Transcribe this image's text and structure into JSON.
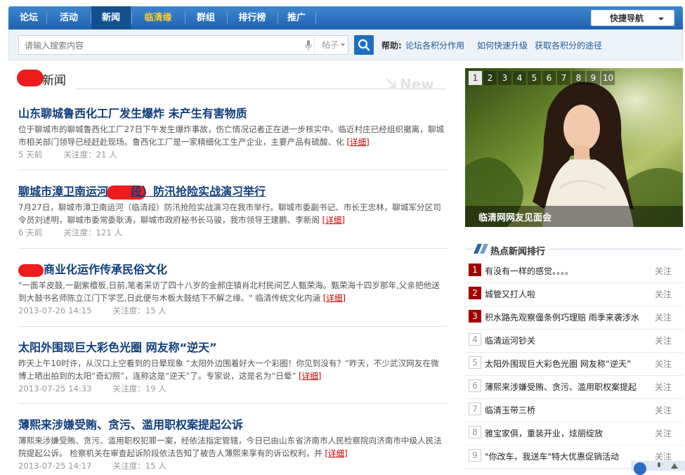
{
  "topnav": {
    "items": [
      "论坛",
      "活动",
      "新闻",
      "临清缘",
      "群组",
      "排行榜",
      "推广"
    ],
    "active": "新闻",
    "highlight": "临清缘",
    "quick_nav": "快捷导航"
  },
  "search": {
    "placeholder": "请输入搜索内容",
    "scope": "帖子",
    "help_label": "帮助:",
    "help_links": [
      "论坛各积分作用",
      "如何快速升级",
      "获取各积分的途径"
    ]
  },
  "news_section": {
    "title": "新闻",
    "watermark": "New"
  },
  "articles": [
    {
      "title": "山东聊城鲁西化工厂发生爆炸 未产生有害物质",
      "summary": "位于聊城市的聊城鲁西化工厂27日下午发生爆炸事故，伤亡情况记者正在进一步核实中。临近村庄已经组织撤离，聊城市相关部门领导已经赶赴现场。鲁西化工厂是一家精细化工生产企业，主要产品有硫酸、化",
      "detail": "[详细]",
      "date": "5 天前",
      "follow": "关注度：21 人"
    },
    {
      "title_a": "聊城市漳卫南运河（",
      "title_b": "段）防汛抢险实战演习举行",
      "summary": "7月27日，聊城市漳卫南运河（临清段）防汛抢险实战演习在我市举行。聊城市委副书记、市长王忠林，聊城军分区司令员刘述明，聊城市委常委耿涛，聊城市政府秘书长马骏，我市领导王建鹏、李新阁",
      "detail": "[详细]",
      "date": "6 天前",
      "follow": "关注度：121 人"
    },
    {
      "title": "商业化运作传承民俗文化",
      "summary": "\"一面羊皮鼓,一副紫檀板,日前,笔者采访了四十八岁的金郝庄镇肖北村民间艺人甄荣海。甄荣海十四岁那年,父亲把他送到大鼓书名师陈立江门下学艺,日此便与木板大鼓结下不解之缘。\"      临清传统文化内涵",
      "detail": "[详细]",
      "date": "2013-07-26 14:15",
      "follow": "关注度：15 人"
    },
    {
      "title": "太阳外围现巨大彩色光圈 网友称“逆天”",
      "summary": "昨天上午10时许，从汉口上空看到的日晕现象 “太阳外边围着好大一个彩圈！你见到没有？”昨天，不少武汉网友在微博上晒出拍到的太阳“奇幻照”，连称这是“逆天”了。专家说，这是名为“日晕”",
      "detail": "[详细]",
      "date": "2013-07-25 14:33",
      "follow": "关注度：19 人"
    },
    {
      "title": "薄熙来涉嫌受贿、贪污、滥用职权案提起公诉",
      "summary": "薄熙来涉嫌受贿、贪污、滥用职权犯罪一案，经依法指定管辖，今日已由山东省济南市人民检察院向济南市中级人民法院提起公诉。 检察机关在审查起诉阶段依法告知了被告人薄熙来享有的诉讼权利，并",
      "detail": "[详细]",
      "date": "2013-07-25 14:17",
      "follow": "关注度：15 人"
    }
  ],
  "slideshow": {
    "numbers": [
      "1",
      "2",
      "3",
      "4",
      "5",
      "6",
      "7",
      "8",
      "9",
      "10"
    ],
    "active": "1",
    "caption": "临清网网友见面会"
  },
  "hot": {
    "title": "热点新闻排行",
    "follow_label": "关注",
    "items": [
      {
        "rank": "1",
        "text": "有没有一样的感觉。。。。"
      },
      {
        "rank": "2",
        "text": "城管又打人啦"
      },
      {
        "rank": "3",
        "text": "积水路先观察僵条例巧理赔 雨季来袭涉水"
      },
      {
        "rank": "4",
        "text": "临清运河钞关"
      },
      {
        "rank": "5",
        "text": "太阳外围现巨大彩色光圈 网友称“逆天”"
      },
      {
        "rank": "6",
        "text": "薄熙来涉嫌受贿、贪污、滥用职权案提起"
      },
      {
        "rank": "7",
        "text": "临清玉带三桥"
      },
      {
        "rank": "8",
        "text": "雅宝家俱，重装开业，炫丽绽放"
      },
      {
        "rank": "9",
        "text": "\"你改车，我送车\"特大优惠促销活动"
      }
    ]
  },
  "colors": {
    "nav_blue": "#1f62b0",
    "title_blue": "#0f3e7c",
    "rank_red": "#a00000",
    "detail_red": "#cc0000"
  }
}
